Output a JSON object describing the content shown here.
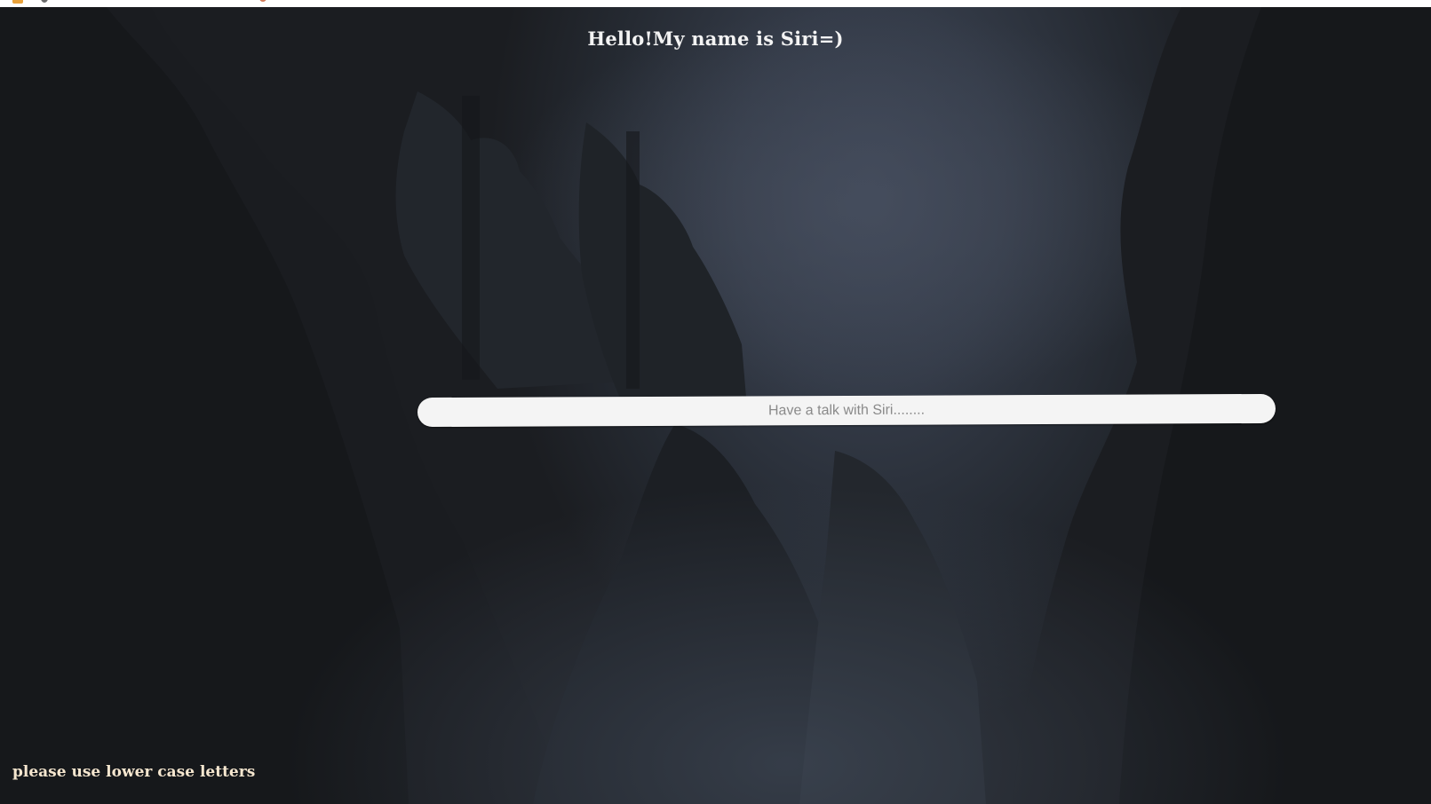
{
  "header": {
    "title": "Hello!My name is Siri=)"
  },
  "chat": {
    "placeholder": "Have a talk with Siri........"
  },
  "footer": {
    "hint": "please use lower case letters"
  },
  "background": {
    "scene": "forest-night-photo",
    "colors": {
      "sky": "#3d4555",
      "trees": "#1b1d21",
      "hint_text": "#f5e6cf"
    }
  }
}
